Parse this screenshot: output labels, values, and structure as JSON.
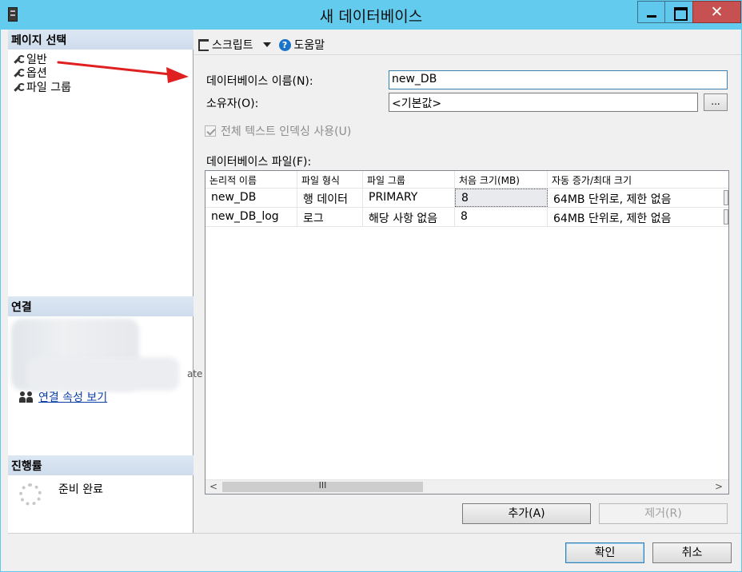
{
  "window": {
    "title": "새 데이터베이스"
  },
  "left": {
    "page_select_header": "페이지 선택",
    "pages": [
      {
        "label": "일반",
        "icon": "wrench-icon"
      },
      {
        "label": "옵션",
        "icon": "wrench-icon"
      },
      {
        "label": "파일 그룹",
        "icon": "wrench-icon"
      }
    ],
    "connection_header": "연결",
    "connection_tail": "ate",
    "connection_link": "연결 속성 보기",
    "progress_header": "진행률",
    "progress_status": "준비 완료"
  },
  "toolbar": {
    "script_label": "스크립트",
    "help_label": "도움말"
  },
  "form": {
    "db_name_label": "데이터베이스 이름(N):",
    "db_name_value": "new_DB",
    "owner_label": "소유자(O):",
    "owner_value": "<기본값>",
    "browse_label": "...",
    "fulltext_label": "전체 텍스트 인덱싱 사용(U)",
    "files_label": "데이터베이스 파일(F):"
  },
  "grid": {
    "columns": [
      "논리적 이름",
      "파일 형식",
      "파일 그룹",
      "처음 크기(MB)",
      "자동 증가/최대 크기"
    ],
    "rows": [
      [
        "new_DB",
        "행 데이터",
        "PRIMARY",
        "8",
        "64MB 단위로, 제한 없음"
      ],
      [
        "new_DB_log",
        "로그",
        "해당 사항 없음",
        "8",
        "64MB 단위로, 제한 없음"
      ]
    ],
    "scroll_grip": "III"
  },
  "buttons": {
    "add": "추가(A)",
    "remove": "제거(R)",
    "ok": "확인",
    "cancel": "취소"
  },
  "colors": {
    "titlebar": "#62cbee",
    "close": "#c75050",
    "arrow": "#e02020",
    "link": "#0b3fa6"
  }
}
